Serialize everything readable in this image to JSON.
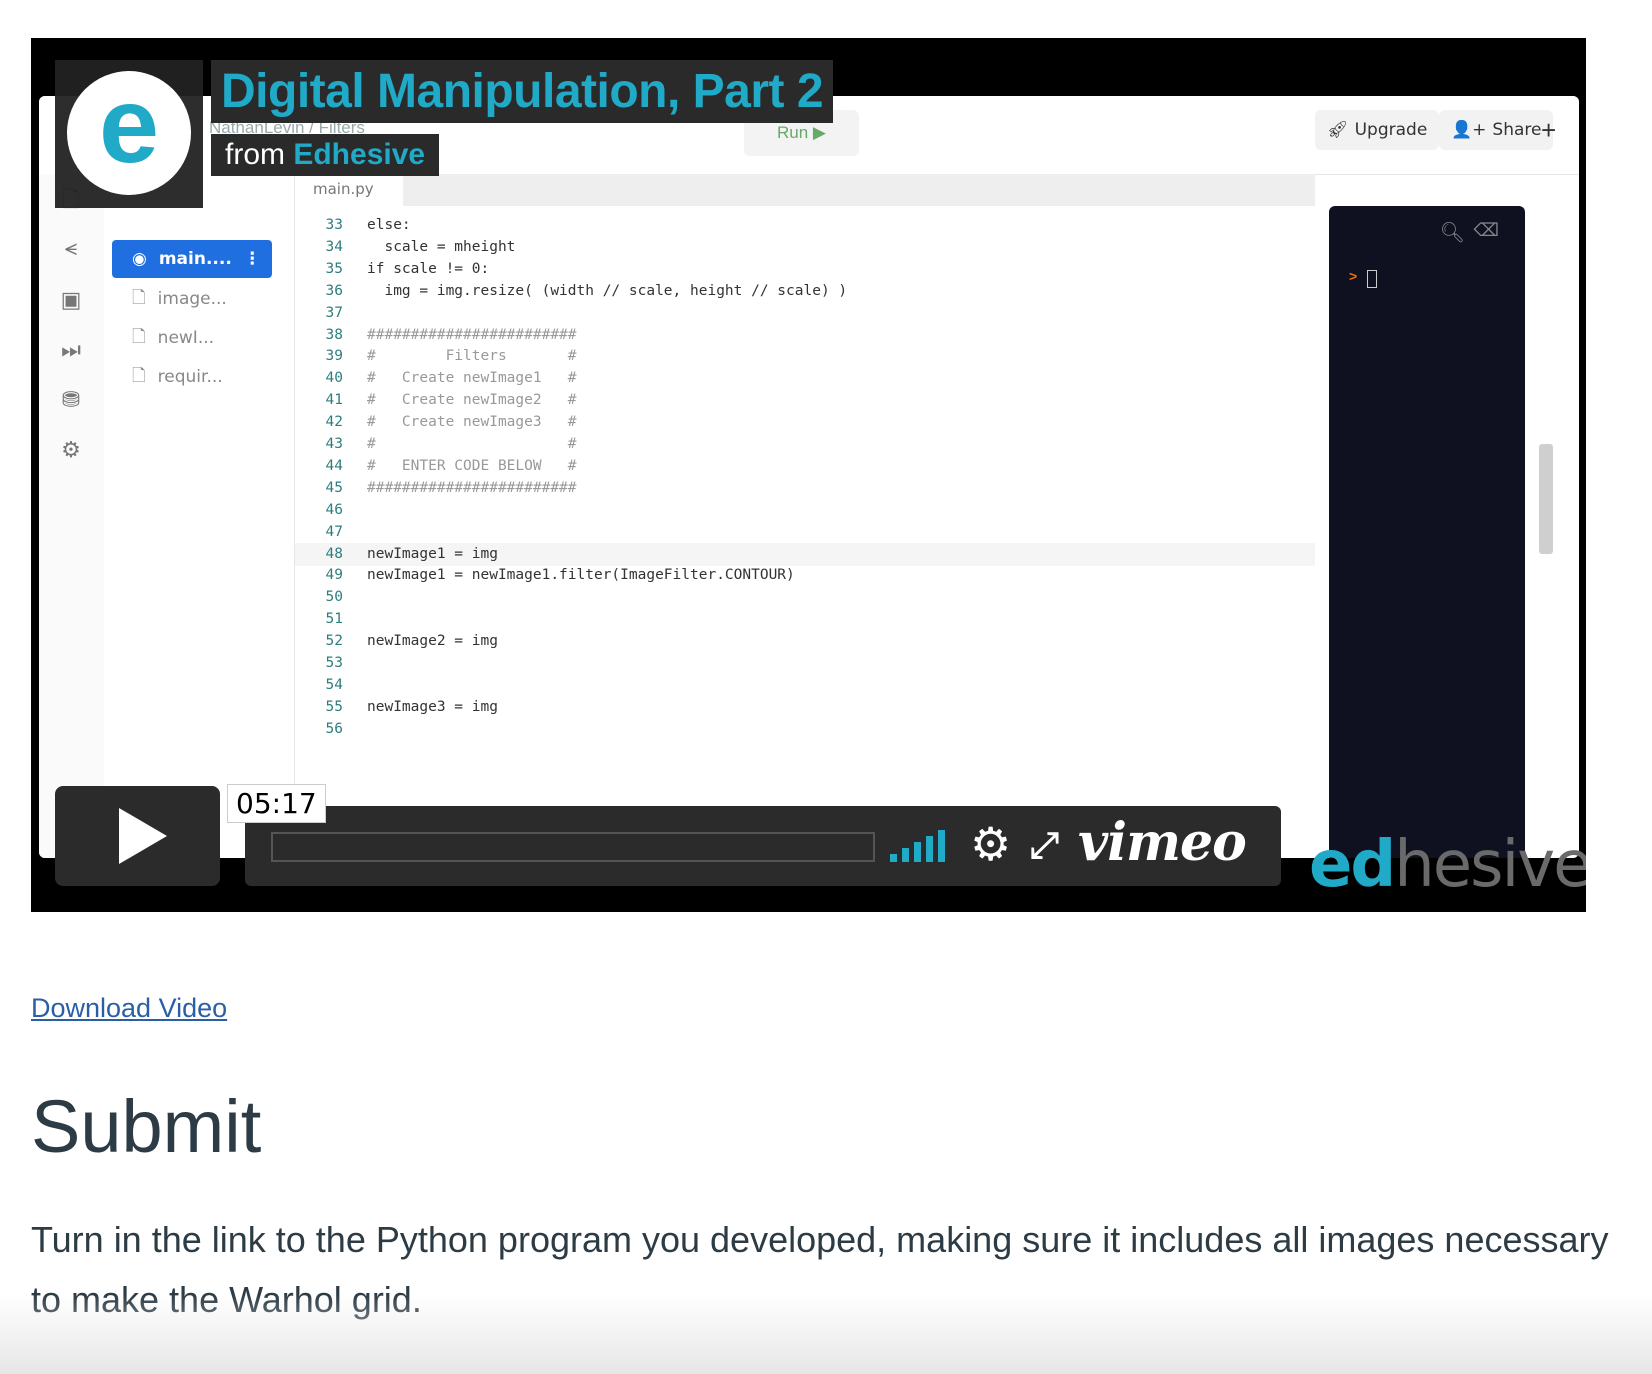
{
  "video": {
    "title": "Digital Manipulation, Part 2",
    "from_prefix": "from",
    "from_brand": "Edhesive",
    "logo_letter": "e",
    "timestamp": "05:17",
    "vimeo_label": "vimeo",
    "watermark_ed": "ed",
    "watermark_rest": "hesive",
    "brand_color": "#21aac7",
    "ide": {
      "breadcrumb": "NathanLevin / Filters",
      "run_label": "Run ▶",
      "upgrade_label": "Upgrade",
      "share_label": "Share",
      "plus_label": "+",
      "tab_label": "main.py",
      "files": [
        {
          "name": "main....",
          "active": true
        },
        {
          "name": "image..."
        },
        {
          "name": "newI..."
        },
        {
          "name": "requir..."
        }
      ],
      "code_lines": [
        {
          "n": "33",
          "text": "else:"
        },
        {
          "n": "34",
          "text": "  scale = mheight"
        },
        {
          "n": "35",
          "text": "if scale != 0:"
        },
        {
          "n": "36",
          "text": "  img = img.resize( (width // scale, height // scale) )"
        },
        {
          "n": "37",
          "text": ""
        },
        {
          "n": "38",
          "text": "########################"
        },
        {
          "n": "39",
          "text": "#        Filters       #"
        },
        {
          "n": "40",
          "text": "#   Create newImage1   #"
        },
        {
          "n": "41",
          "text": "#   Create newImage2   #"
        },
        {
          "n": "42",
          "text": "#   Create newImage3   #"
        },
        {
          "n": "43",
          "text": "#                      #"
        },
        {
          "n": "44",
          "text": "#   ENTER CODE BELOW   #"
        },
        {
          "n": "45",
          "text": "########################"
        },
        {
          "n": "46",
          "text": ""
        },
        {
          "n": "47",
          "text": ""
        },
        {
          "n": "48",
          "text": "newImage1 = img"
        },
        {
          "n": "49",
          "text": "newImage1 = newImage1.filter(ImageFilter.CONTOUR)"
        },
        {
          "n": "50",
          "text": ""
        },
        {
          "n": "51",
          "text": ""
        },
        {
          "n": "52",
          "text": "newImage2 = img"
        },
        {
          "n": "53",
          "text": ""
        },
        {
          "n": "54",
          "text": ""
        },
        {
          "n": "55",
          "text": "newImage3 = img"
        },
        {
          "n": "56",
          "text": ""
        }
      ],
      "console_prompt": ">"
    }
  },
  "page": {
    "download_link": "Download Video",
    "section_title": "Submit",
    "section_body": "Turn in the link to the Python program you developed, making sure it includes all images necessary to make the Warhol grid."
  }
}
